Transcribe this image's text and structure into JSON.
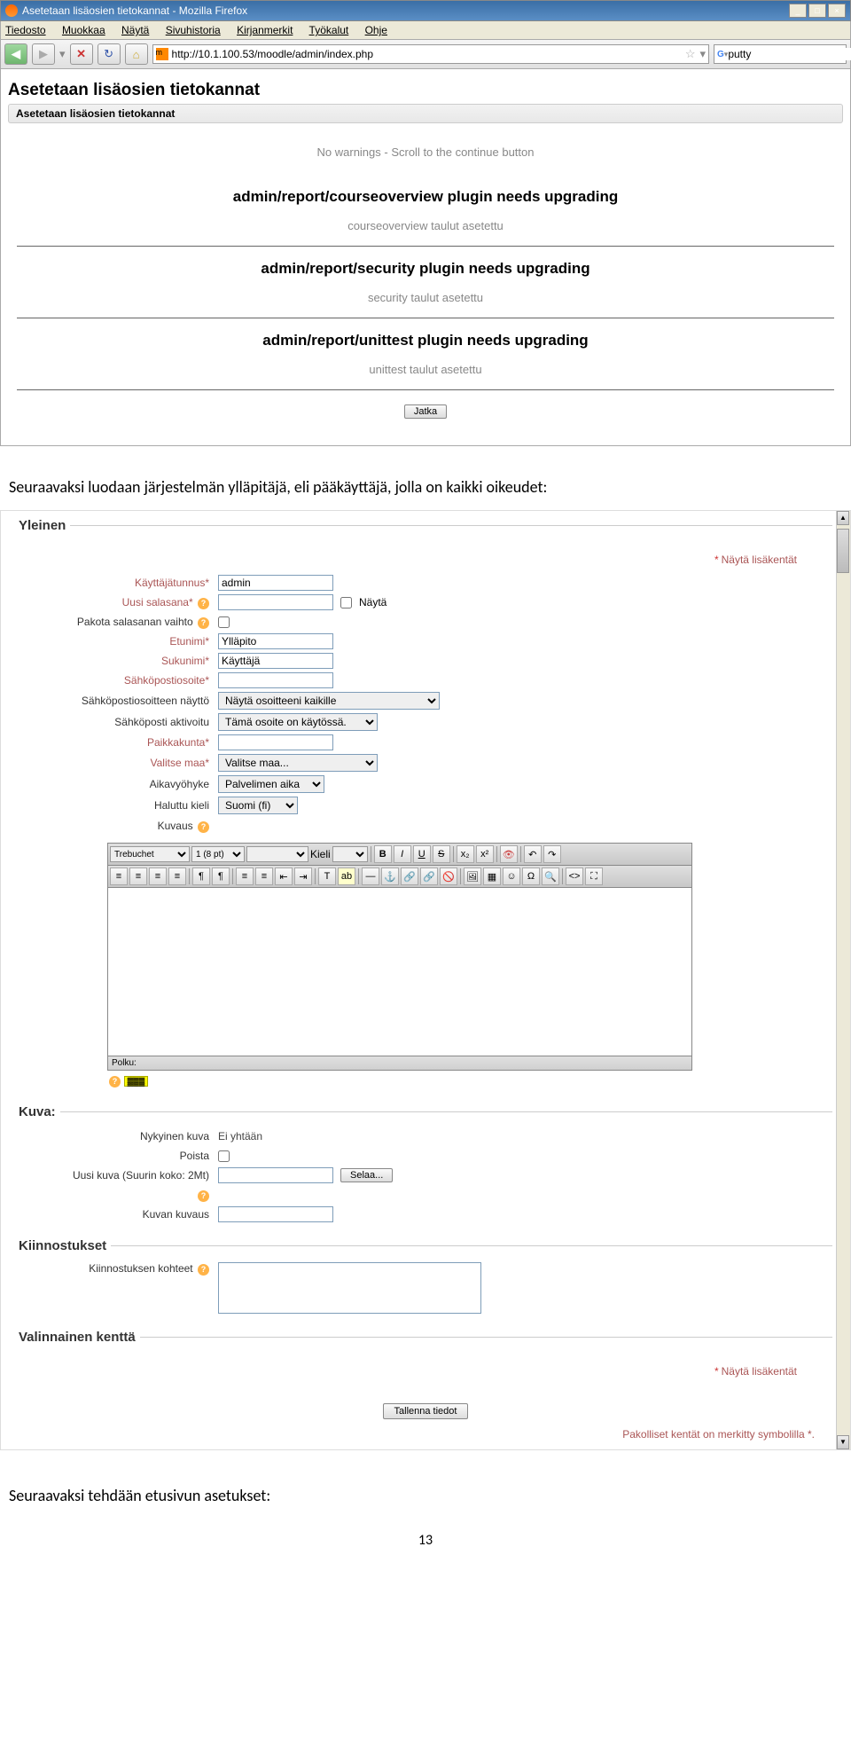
{
  "browser": {
    "title": "Asetetaan lisäosien tietokannat - Mozilla Firefox",
    "menus": [
      "Tiedosto",
      "Muokkaa",
      "Näytä",
      "Sivuhistoria",
      "Kirjanmerkit",
      "Työkalut",
      "Ohje"
    ],
    "url": "http://10.1.100.53/moodle/admin/index.php",
    "search_value": "putty"
  },
  "install": {
    "heading": "Asetetaan lisäosien tietokannat",
    "subheading": "Asetetaan lisäosien tietokannat",
    "no_warnings": "No warnings - Scroll to the continue button",
    "p1_h": "admin/report/courseoverview plugin needs upgrading",
    "p1_s": "courseoverview taulut asetettu",
    "p2_h": "admin/report/security plugin needs upgrading",
    "p2_s": "security taulut asetettu",
    "p3_h": "admin/report/unittest plugin needs upgrading",
    "p3_s": "unittest taulut asetettu",
    "continue_btn": "Jatka"
  },
  "narration1": "Seuraavaksi luodaan järjestelmän ylläpitäjä, eli pääkäyttäjä, jolla on kaikki oikeudet:",
  "form": {
    "legend_general": "Yleinen",
    "show_extra": "Näytä lisäkentät",
    "fields": {
      "username": {
        "label": "Käyttäjätunnus*",
        "value": "admin"
      },
      "newpass": {
        "label": "Uusi salasana*",
        "show_label": "Näytä"
      },
      "forcepass": {
        "label": "Pakota salasanan vaihto"
      },
      "firstname": {
        "label": "Etunimi*",
        "value": "Ylläpito"
      },
      "lastname": {
        "label": "Sukunimi*",
        "value": "Käyttäjä"
      },
      "email": {
        "label": "Sähköpostiosoite*"
      },
      "emaildisplay": {
        "label": "Sähköpostiosoitteen näyttö",
        "value": "Näytä osoitteeni kaikille"
      },
      "emailactive": {
        "label": "Sähköposti aktivoitu",
        "value": "Tämä osoite on käytössä."
      },
      "city": {
        "label": "Paikkakunta*"
      },
      "country": {
        "label": "Valitse maa*",
        "value": "Valitse maa..."
      },
      "timezone": {
        "label": "Aikavyöhyke",
        "value": "Palvelimen aika"
      },
      "lang": {
        "label": "Haluttu kieli",
        "value": "Suomi (fi)"
      },
      "desc": {
        "label": "Kuvaus"
      }
    },
    "editor": {
      "font": "Trebuchet",
      "size": "1 (8 pt)",
      "lang_label": "Kieli",
      "path_label": "Polku:"
    },
    "legend_image": "Kuva:",
    "image": {
      "current_label": "Nykyinen kuva",
      "current_value": "Ei yhtään",
      "delete_label": "Poista",
      "new_label": "Uusi kuva (Suurin koko: 2Mt)",
      "browse_btn": "Selaa...",
      "desc_label": "Kuvan kuvaus"
    },
    "legend_interests": "Kiinnostukset",
    "interests_label": "Kiinnostuksen kohteet",
    "legend_optional": "Valinnainen kenttä",
    "save_btn": "Tallenna tiedot",
    "required_note": "Pakolliset kentät on merkitty symbolilla *."
  },
  "narration2": "Seuraavaksi tehdään etusivun asetukset:",
  "pagenum": "13"
}
